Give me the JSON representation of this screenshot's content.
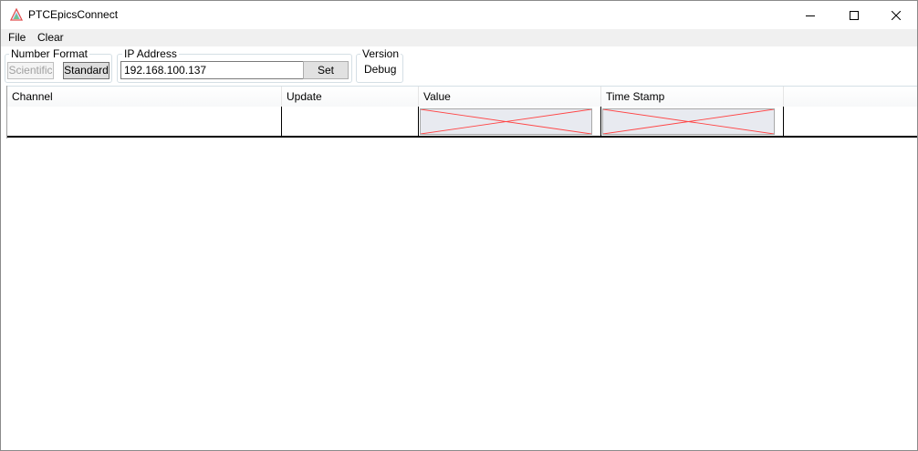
{
  "window": {
    "title": "PTCEpicsConnect",
    "icon": "triangle-logo-icon",
    "controls": [
      "minimize-icon",
      "maximize-icon",
      "close-icon"
    ]
  },
  "menu": {
    "file": "File",
    "clear": "Clear"
  },
  "number_format": {
    "label": "Number Format",
    "scientific": "Scientific",
    "standard": "Standard",
    "selected": "Standard"
  },
  "ip_address": {
    "label": "IP Address",
    "value": "192.168.100.137",
    "set_label": "Set"
  },
  "version": {
    "label": "Version",
    "value": "Debug"
  },
  "grid": {
    "columns": [
      "Channel",
      "Update",
      "Value",
      "Time Stamp",
      ""
    ],
    "rows": [
      {
        "channel": "",
        "update": "",
        "value": "",
        "timestamp": ""
      }
    ]
  },
  "colors": {
    "placeholder_cross": "#ff4444",
    "placeholder_fill": "#e8eaf0",
    "menu_bg": "#f0f0f0"
  }
}
